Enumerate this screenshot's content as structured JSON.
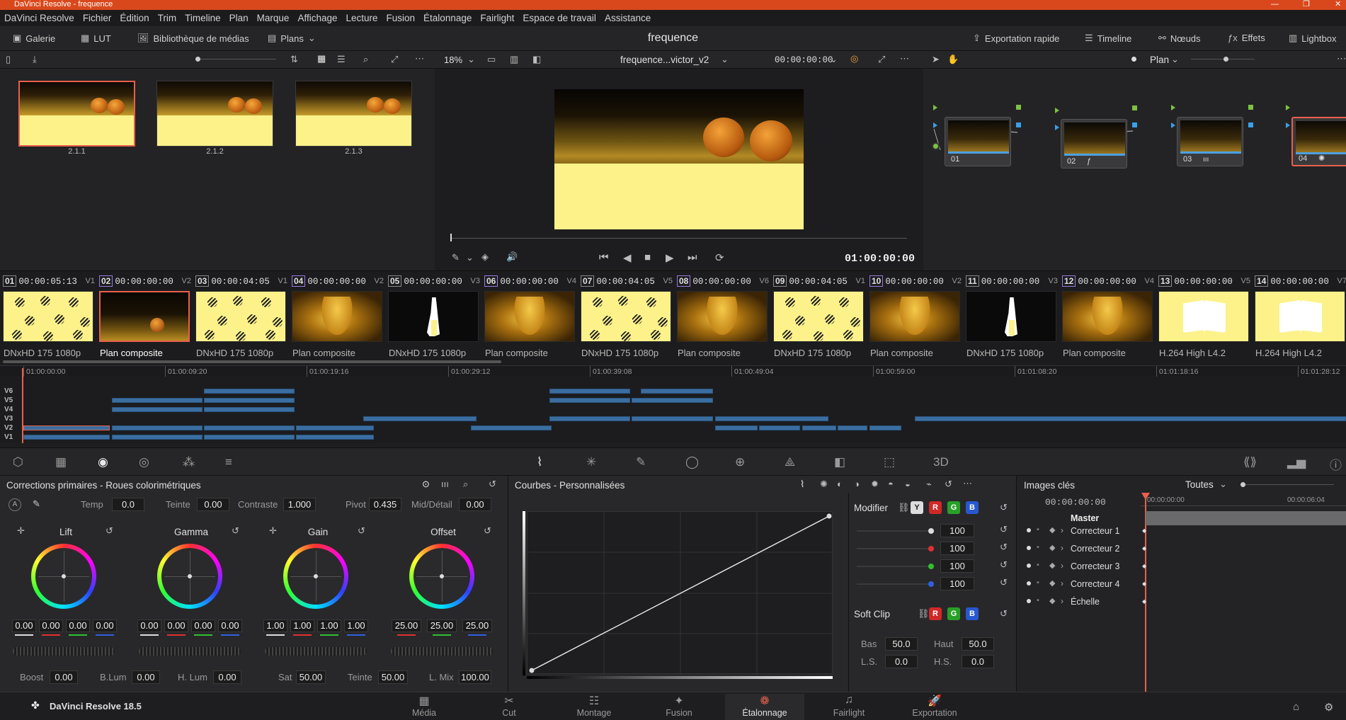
{
  "window": {
    "title": "DaVinci Resolve - frequence"
  },
  "menu": [
    "DaVinci Resolve",
    "Fichier",
    "Édition",
    "Trim",
    "Timeline",
    "Plan",
    "Marque",
    "Affichage",
    "Lecture",
    "Fusion",
    "Étalonnage",
    "Fairlight",
    "Espace de travail",
    "Assistance"
  ],
  "toolbar": {
    "gallery": "Galerie",
    "lut": "LUT",
    "media": "Bibliothèque de médias",
    "plans": "Plans",
    "project": "frequence",
    "export": "Exportation rapide",
    "timeline": "Timeline",
    "nodes": "Nœuds",
    "effects": "Effets",
    "lightbox": "Lightbox"
  },
  "gallery": {
    "stills": [
      {
        "label": "2.1.1"
      },
      {
        "label": "2.1.2"
      },
      {
        "label": "2.1.3"
      }
    ]
  },
  "viewer": {
    "zoom": "18%",
    "clip_name": "frequence...victor_v2",
    "timecode_top": "00:00:00:00",
    "timecode": "01:00:00:00"
  },
  "nodes": {
    "mode": "Plan",
    "items": [
      {
        "label": "01"
      },
      {
        "label": "02"
      },
      {
        "label": "03"
      },
      {
        "label": "04"
      }
    ]
  },
  "clips": [
    {
      "num": "01",
      "tc": "00:00:05:13",
      "track": "V1",
      "codec": "DNxHD 175 1080p",
      "kind": "zig"
    },
    {
      "num": "02",
      "tc": "00:00:00:00",
      "track": "V2",
      "codec": "Plan composite",
      "kind": "dark"
    },
    {
      "num": "03",
      "tc": "00:00:04:05",
      "track": "V1",
      "codec": "DNxHD 175 1080p",
      "kind": "zig"
    },
    {
      "num": "04",
      "tc": "00:00:00:00",
      "track": "V2",
      "codec": "Plan composite",
      "kind": "girl"
    },
    {
      "num": "05",
      "tc": "00:00:00:00",
      "track": "V3",
      "codec": "DNxHD 175 1080p",
      "kind": "sil"
    },
    {
      "num": "06",
      "tc": "00:00:00:00",
      "track": "V4",
      "codec": "Plan composite",
      "kind": "girl"
    },
    {
      "num": "07",
      "tc": "00:00:04:05",
      "track": "V5",
      "codec": "DNxHD 175 1080p",
      "kind": "zig"
    },
    {
      "num": "08",
      "tc": "00:00:00:00",
      "track": "V6",
      "codec": "Plan composite",
      "kind": "girl"
    },
    {
      "num": "09",
      "tc": "00:00:04:05",
      "track": "V1",
      "codec": "DNxHD 175 1080p",
      "kind": "zig"
    },
    {
      "num": "10",
      "tc": "00:00:00:00",
      "track": "V2",
      "codec": "Plan composite",
      "kind": "girl"
    },
    {
      "num": "11",
      "tc": "00:00:00:00",
      "track": "V3",
      "codec": "DNxHD 175 1080p",
      "kind": "sil"
    },
    {
      "num": "12",
      "tc": "00:00:00:00",
      "track": "V4",
      "codec": "Plan composite",
      "kind": "girl"
    },
    {
      "num": "13",
      "tc": "00:00:00:00",
      "track": "V5",
      "codec": "H.264 High L4.2",
      "kind": "book"
    },
    {
      "num": "14",
      "tc": "00:00:00:00",
      "track": "V7",
      "codec": "H.264 High L4.2",
      "kind": "book"
    }
  ],
  "ruler": [
    "01:00:00:00",
    "01:00:09:20",
    "01:00:19:16",
    "01:00:29:12",
    "01:00:39:08",
    "01:00:49:04",
    "01:00:59:00",
    "01:01:08:20",
    "01:01:18:16",
    "01:01:28:12"
  ],
  "tracks": [
    "V6",
    "V5",
    "V4",
    "V3",
    "V2",
    "V1"
  ],
  "primaries": {
    "title": "Corrections primaires - Roues colorimétriques",
    "temp_label": "Temp",
    "temp": "0.0",
    "tint_label": "Teinte",
    "tint": "0.00",
    "contrast_label": "Contraste",
    "contrast": "1.000",
    "pivot_label": "Pivot",
    "pivot": "0.435",
    "middetail_label": "Mid/Détail",
    "middetail": "0.00",
    "wheels": [
      {
        "name": "Lift",
        "values": [
          "0.00",
          "0.00",
          "0.00",
          "0.00"
        ]
      },
      {
        "name": "Gamma",
        "values": [
          "0.00",
          "0.00",
          "0.00",
          "0.00"
        ]
      },
      {
        "name": "Gain",
        "values": [
          "1.00",
          "1.00",
          "1.00",
          "1.00"
        ]
      },
      {
        "name": "Offset",
        "values": [
          "25.00",
          "25.00",
          "25.00"
        ]
      }
    ],
    "boost_label": "Boost",
    "boost": "0.00",
    "blum_label": "B.Lum",
    "blum": "0.00",
    "hlum_label": "H. Lum",
    "hlum": "0.00",
    "sat_label": "Sat",
    "sat": "50.00",
    "hue_label": "Teinte",
    "hue": "50.00",
    "lmix_label": "L. Mix",
    "lmix": "100.00"
  },
  "curves": {
    "title": "Courbes - Personnalisées",
    "modifier": "Modifier",
    "y": "Y",
    "r": "R",
    "g": "G",
    "b": "B",
    "intensity": [
      "100",
      "100",
      "100",
      "100"
    ],
    "softclip": "Soft Clip",
    "bas_label": "Bas",
    "bas": "50.0",
    "haut_label": "Haut",
    "haut": "50.0",
    "ls_label": "L.S.",
    "ls": "0.0",
    "hs_label": "H.S.",
    "hs": "0.0"
  },
  "keyframes": {
    "title": "Images clés",
    "filter": "Toutes",
    "tc": "00:00:00:00",
    "tc_start": "00:00:00:00",
    "tc_end": "00:00:06:04",
    "master": "Master",
    "rows": [
      "Correcteur 1",
      "Correcteur 2",
      "Correcteur 3",
      "Correcteur 4",
      "Échelle"
    ]
  },
  "bottom": {
    "app": "DaVinci Resolve 18.5",
    "tabs": [
      "Média",
      "Cut",
      "Montage",
      "Fusion",
      "Étalonnage",
      "Fairlight",
      "Exportation"
    ]
  },
  "colors": {
    "accent": "#e8604c",
    "titlebar": "#d9481c",
    "clip_blue": "#3b6ea0"
  }
}
